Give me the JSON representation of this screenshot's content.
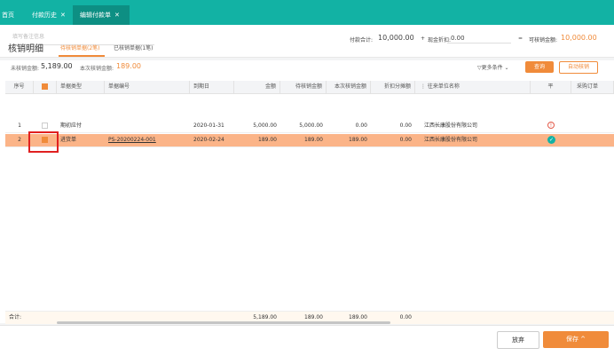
{
  "tabs": [
    {
      "label": "首页",
      "closable": false,
      "active": false
    },
    {
      "label": "付款历史",
      "closable": true,
      "active": false
    },
    {
      "label": "编辑付款单",
      "closable": true,
      "active": true
    }
  ],
  "header": {
    "remark_placeholder": "填写备注信息",
    "total_label": "付款合计:",
    "total_value": "10,000.00",
    "plus": "+",
    "discount_label": "现金折扣:",
    "discount_value": "0.00",
    "equals": "=",
    "writeoff_label": "可核销金额:",
    "writeoff_value": "10,000.00"
  },
  "section": {
    "title": "核销明细",
    "tab_pending": "待核销单据(2笔)",
    "tab_done": "已核销单据(1笔)"
  },
  "stats": {
    "unwritten_label": "未核销金额:",
    "unwritten_value": "5,189.00",
    "current_label": "本次核销金额:",
    "current_value": "189.00"
  },
  "toolbar": {
    "more_label": "更多条件",
    "query_label": "查询",
    "auto_label": "自动核销"
  },
  "table": {
    "headers": {
      "seq": "序号",
      "doc_type": "单据类型",
      "doc_no": "单据编号",
      "due_date": "到期日",
      "amount": "金额",
      "pending": "待核销金额",
      "current": "本次核销金额",
      "discount": "折扣分摊额",
      "partner": "往来单位名称",
      "flag": "平",
      "purchase": "采购订单"
    },
    "rows": [
      {
        "seq": "1",
        "checked": false,
        "doc_type": "期初应付",
        "doc_no": "",
        "due_date": "2020-01-31",
        "amount": "5,000.00",
        "pending": "5,000.00",
        "current": "0.00",
        "discount": "0.00",
        "partner": "江西长康股份有限公司",
        "status_icon": "warning-icon"
      },
      {
        "seq": "2",
        "checked": true,
        "doc_type": "进货单",
        "doc_no": "PS-20200224-001",
        "due_date": "2020-02-24",
        "amount": "189.00",
        "pending": "189.00",
        "current": "189.00",
        "discount": "0.00",
        "partner": "江西长康股份有限公司",
        "status_icon": "check-icon"
      }
    ],
    "footer": {
      "label": "合计:",
      "amount": "5,189.00",
      "pending": "189.00",
      "current": "189.00",
      "discount": "0.00"
    }
  },
  "actions": {
    "cancel_label": "放弃",
    "save_label": "保存"
  },
  "colors": {
    "teal": "#12b2a4",
    "orange": "#f08b3a",
    "selected_row": "#fbb488",
    "highlight_box": "#e02020"
  }
}
